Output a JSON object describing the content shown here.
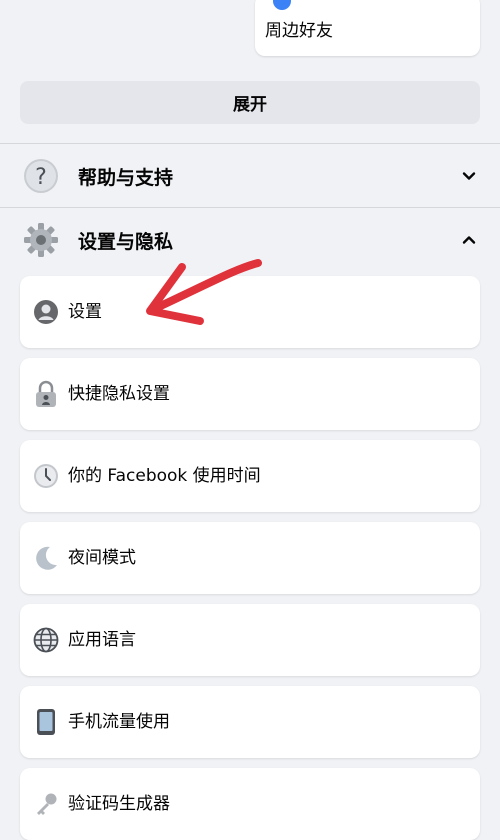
{
  "top_card": {
    "label": "周边好友"
  },
  "expand_button": {
    "label": "展开"
  },
  "sections": {
    "help": {
      "label": "帮助与支持",
      "icon": "question-mark-icon",
      "state": "collapsed"
    },
    "settings_privacy": {
      "label": "设置与隐私",
      "icon": "gear-icon",
      "state": "expanded"
    }
  },
  "menu_items": [
    {
      "label": "设置",
      "icon": "profile-icon"
    },
    {
      "label": "快捷隐私设置",
      "icon": "lock-icon"
    },
    {
      "label": "你的 Facebook 使用时间",
      "icon": "clock-icon"
    },
    {
      "label": "夜间模式",
      "icon": "moon-icon"
    },
    {
      "label": "应用语言",
      "icon": "globe-icon"
    },
    {
      "label": "手机流量使用",
      "icon": "phone-icon"
    },
    {
      "label": "验证码生成器",
      "icon": "key-icon"
    }
  ],
  "colors": {
    "background": "#f0f2f5",
    "card": "#ffffff",
    "button": "#e4e6eb",
    "annotation_arrow": "#e0323b"
  }
}
